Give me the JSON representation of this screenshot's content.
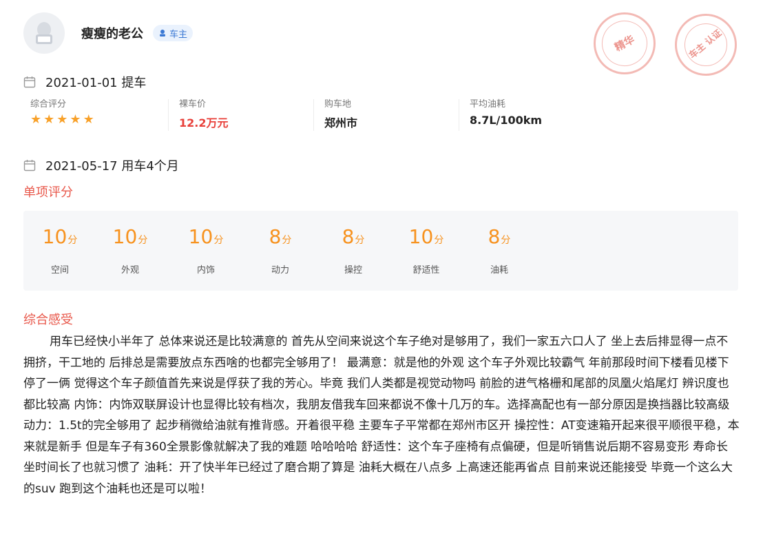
{
  "user": {
    "name": "瘦瘦的老公",
    "badge": "车主"
  },
  "stamps": {
    "elite": "精华",
    "owner_certified": "车主 认证"
  },
  "purchase": {
    "date_label": "2021-01-01 提车",
    "items": [
      {
        "label": "综合评分",
        "value": "",
        "stars": 5
      },
      {
        "label": "裸车价",
        "value": "12.2万元"
      },
      {
        "label": "购车地",
        "value": "郑州市"
      },
      {
        "label": "平均油耗",
        "value": "8.7L/100km"
      }
    ]
  },
  "usage": {
    "date_label": "2021-05-17 用车4个月"
  },
  "ratings": {
    "title": "单项评分",
    "unit": "分",
    "items": [
      {
        "value": "10",
        "label": "空间"
      },
      {
        "value": "10",
        "label": "外观"
      },
      {
        "value": "10",
        "label": "内饰"
      },
      {
        "value": "8",
        "label": "动力"
      },
      {
        "value": "8",
        "label": "操控"
      },
      {
        "value": "10",
        "label": "舒适性"
      },
      {
        "value": "8",
        "label": "油耗"
      }
    ]
  },
  "review": {
    "title": "综合感受",
    "text": "用车已经快小半年了 总体来说还是比较满意的 首先从空间来说这个车子绝对是够用了，我们一家五六口人了 坐上去后排显得一点不拥挤，干工地的 后排总是需要放点东西啥的也都完全够用了！ 最满意：就是他的外观 这个车子外观比较霸气 年前那段时间下楼看见楼下停了一俩 觉得这个车子颜值首先来说是俘获了我的芳心。毕竟 我们人类都是视觉动物吗 前脸的进气格栅和尾部的凤凰火焰尾灯 辨识度也都比较高 内饰：内饰双联屏设计也显得比较有档次，我朋友借我车回来都说不像十几万的车。选择高配也有一部分原因是换挡器比较高级 动力：1.5t的完全够用了 起步稍微给油就有推背感。开着很平稳 主要车子平常都在郑州市区开 操控性：AT变速箱开起来很平顺很平稳，本来就是新手 但是车子有360全景影像就解决了我的难题 哈哈哈哈 舒适性：这个车子座椅有点偏硬，但是听销售说后期不容易变形 寿命长 坐时间长了也就习惯了 油耗：开了快半年已经过了磨合期了算是 油耗大概在八点多 上高速还能再省点 目前来说还能接受 毕竟一个这么大的suv 跑到这个油耗也还是可以啦！"
  },
  "colors": {
    "accent": "#e8574a",
    "score": "#f7921e",
    "price": "#e8403a",
    "star": "#f8a12a"
  }
}
